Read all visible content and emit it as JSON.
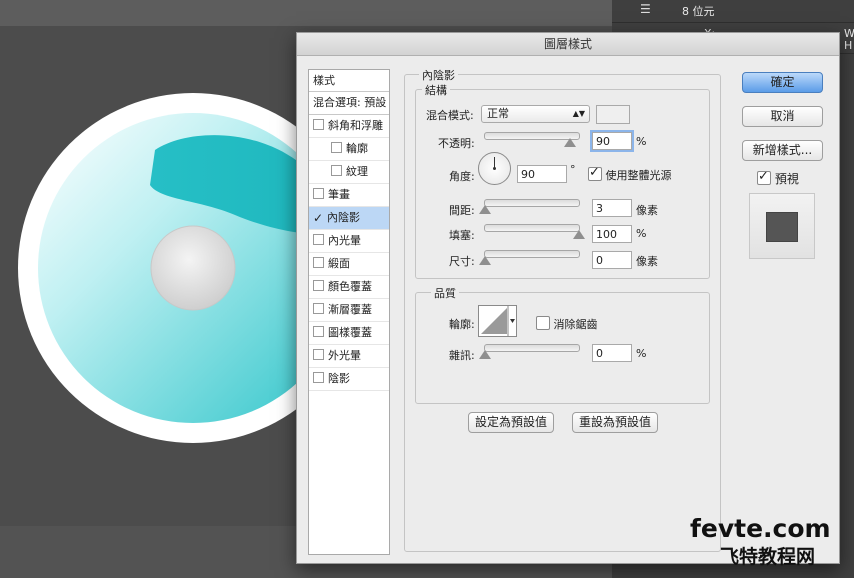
{
  "window": {
    "title": "圖層樣式"
  },
  "right_panel": {
    "bits_label": "8 位元",
    "x_label": "X:",
    "w_label": "W",
    "h_label": "H"
  },
  "style_list": {
    "header": "樣式",
    "blend_options": "混合選項: 預設",
    "items": [
      {
        "label": "斜角和浮雕",
        "checked": false
      },
      {
        "label": "輪廓",
        "checked": false,
        "sub": true
      },
      {
        "label": "紋理",
        "checked": false,
        "sub": true
      },
      {
        "label": "筆畫",
        "checked": false
      },
      {
        "label": "內陰影",
        "checked": true,
        "selected": true
      },
      {
        "label": "內光暈",
        "checked": false
      },
      {
        "label": "緞面",
        "checked": false
      },
      {
        "label": "顏色覆蓋",
        "checked": false
      },
      {
        "label": "漸層覆蓋",
        "checked": false
      },
      {
        "label": "圖樣覆蓋",
        "checked": false
      },
      {
        "label": "外光暈",
        "checked": false
      },
      {
        "label": "陰影",
        "checked": false
      }
    ]
  },
  "inner_shadow": {
    "section_title": "內陰影",
    "structure": {
      "title": "結構",
      "blend_mode_label": "混合模式:",
      "blend_mode_value": "正常",
      "opacity_label": "不透明:",
      "opacity_value": "90",
      "opacity_unit": "%",
      "opacity_fraction": 0.9,
      "angle_label": "角度:",
      "angle_value": "90",
      "angle_unit": "°",
      "global_light_label": "使用整體光源",
      "global_light_checked": true,
      "distance_label": "間距:",
      "distance_value": "3",
      "distance_unit": "像素",
      "distance_fraction": 0.0,
      "choke_label": "填塞:",
      "choke_value": "100",
      "choke_unit": "%",
      "choke_fraction": 1.0,
      "size_label": "尺寸:",
      "size_value": "0",
      "size_unit": "像素",
      "size_fraction": 0.0
    },
    "quality": {
      "title": "品質",
      "contour_label": "輪廓:",
      "antialias_label": "消除鋸齒",
      "antialias_checked": false,
      "noise_label": "雜訊:",
      "noise_value": "0",
      "noise_unit": "%",
      "noise_fraction": 0.0
    },
    "make_default": "設定為預設值",
    "reset_default": "重設為預設值"
  },
  "buttons": {
    "ok": "確定",
    "cancel": "取消",
    "new_style": "新增樣式...",
    "preview": "預視",
    "preview_checked": true
  },
  "watermark": {
    "line1": "fevte.com",
    "line2": "飞特教程网"
  },
  "colors": {
    "accent_teal": "#22c2c8",
    "selection": "#bcd7f5",
    "primary_button": "#5b9ce8"
  }
}
